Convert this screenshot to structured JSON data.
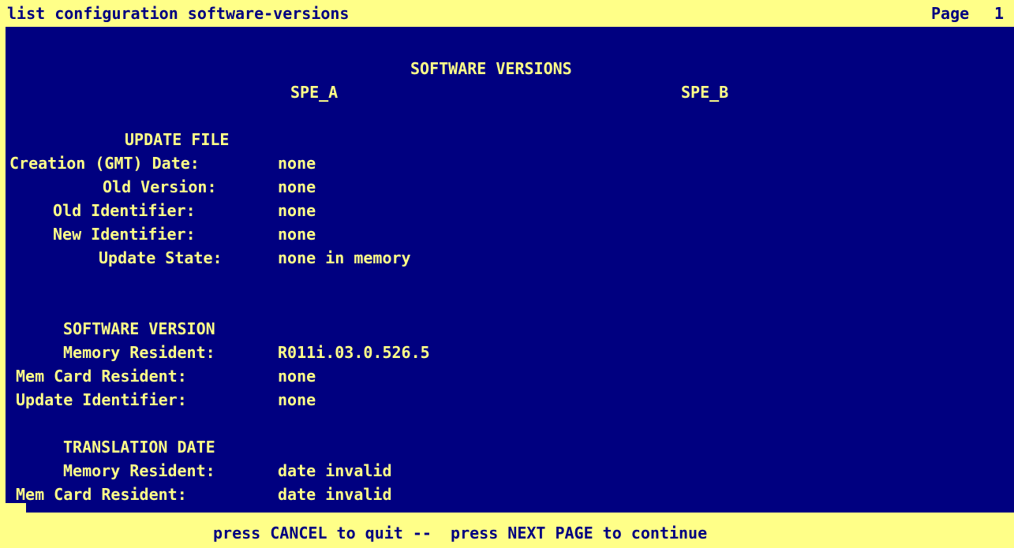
{
  "command_line": "list configuration software-versions",
  "page_indicator": {
    "label": "Page",
    "number": "1"
  },
  "screen_title": "SOFTWARE VERSIONS",
  "columns": {
    "spe_a": "SPE_A",
    "spe_b": "SPE_B"
  },
  "update_file": {
    "heading": "UPDATE FILE",
    "fields": [
      {
        "label": "Creation (GMT) Date:",
        "value": "none"
      },
      {
        "label": "Old Version:",
        "value": "none"
      },
      {
        "label": "Old Identifier:",
        "value": "none"
      },
      {
        "label": "New Identifier:",
        "value": "none"
      },
      {
        "label": "Update State:",
        "value": "none in memory"
      }
    ]
  },
  "software_version": {
    "heading": "SOFTWARE VERSION",
    "fields": [
      {
        "label": "Memory Resident:",
        "value": "R011i.03.0.526.5"
      },
      {
        "label": "Mem Card Resident:",
        "value": "none"
      },
      {
        "label": "Update Identifier:",
        "value": "none"
      }
    ]
  },
  "translation_date": {
    "heading": "TRANSLATION DATE",
    "fields": [
      {
        "label": "Memory Resident:",
        "value": "date invalid"
      },
      {
        "label": "Mem Card Resident:",
        "value": "date invalid"
      }
    ]
  },
  "footer": {
    "prompt": "press CANCEL to quit --  press NEXT PAGE to continue"
  },
  "colors": {
    "background": "#000080",
    "foreground": "#ffff88"
  }
}
